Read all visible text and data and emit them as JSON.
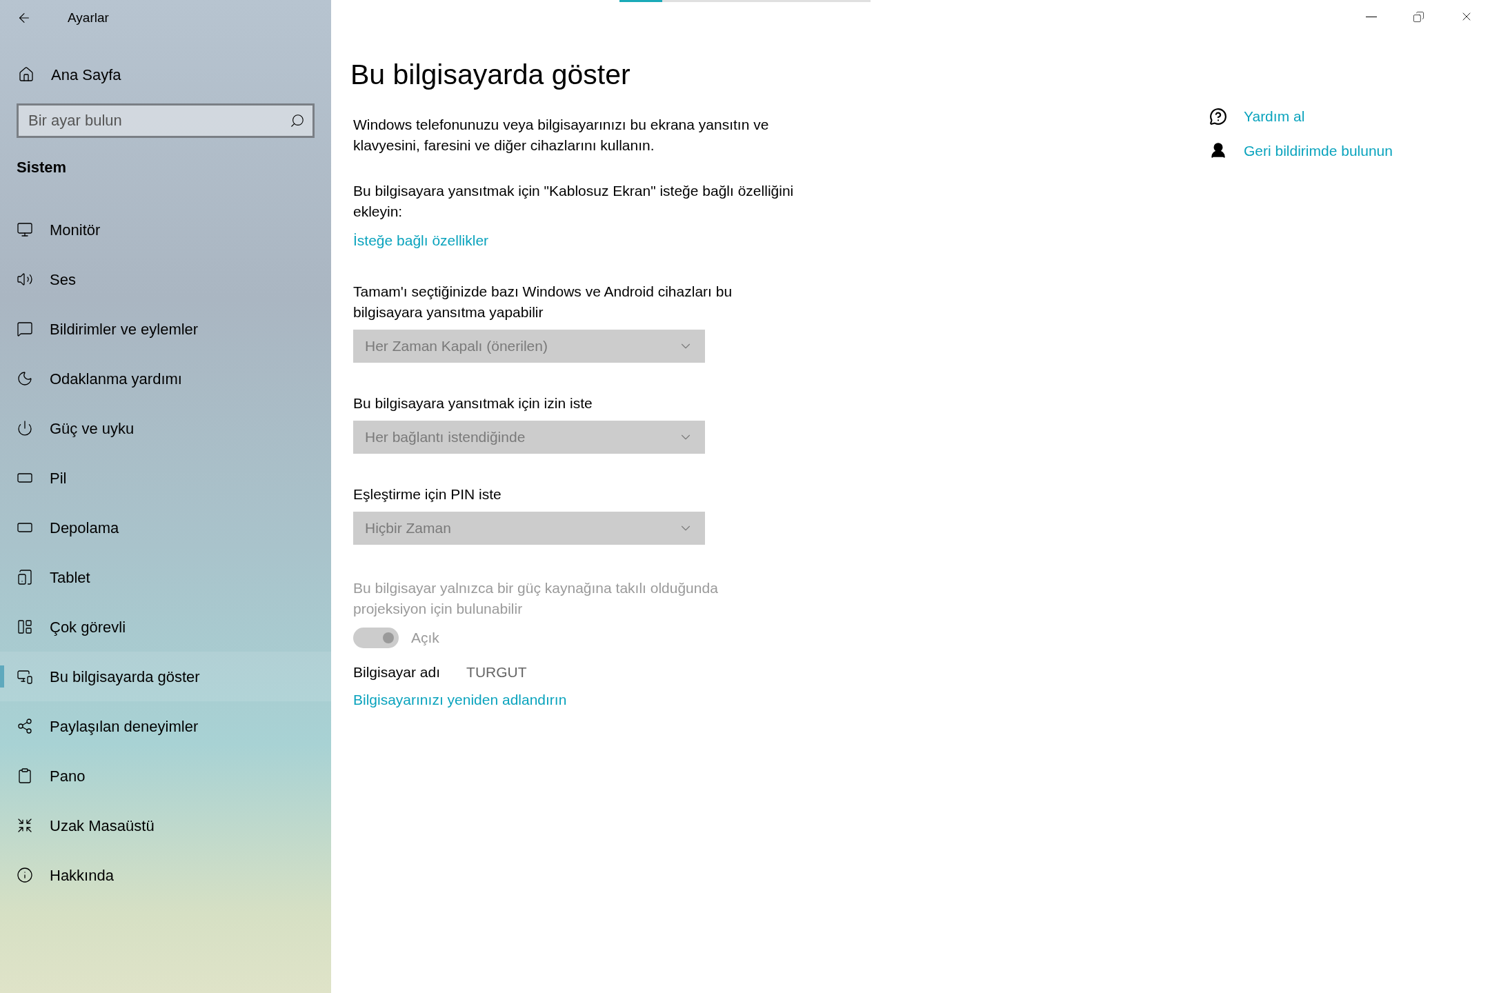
{
  "window": {
    "title": "Ayarlar"
  },
  "sidebar": {
    "home": "Ana Sayfa",
    "search": {
      "placeholder": "Bir ayar bulun"
    },
    "section": "Sistem",
    "items": [
      {
        "label": "Monitör",
        "selected": false
      },
      {
        "label": "Ses",
        "selected": false
      },
      {
        "label": "Bildirimler ve eylemler",
        "selected": false
      },
      {
        "label": "Odaklanma yardımı",
        "selected": false
      },
      {
        "label": "Güç ve uyku",
        "selected": false
      },
      {
        "label": "Pil",
        "selected": false
      },
      {
        "label": "Depolama",
        "selected": false
      },
      {
        "label": "Tablet",
        "selected": false
      },
      {
        "label": "Çok görevli",
        "selected": false
      },
      {
        "label": "Bu bilgisayarda göster",
        "selected": true
      },
      {
        "label": "Paylaşılan deneyimler",
        "selected": false
      },
      {
        "label": "Pano",
        "selected": false
      },
      {
        "label": "Uzak Masaüstü",
        "selected": false
      },
      {
        "label": "Hakkında",
        "selected": false
      }
    ]
  },
  "progress": {
    "level": 0.17
  },
  "page": {
    "title": "Bu bilgisayarda göster",
    "intro": "Windows telefonunuzu veya bilgisayarınızı bu ekrana yansıtın ve klavyesini, faresini ve diğer cihazlarını kullanın.",
    "feature_text": "Bu bilgisayara yansıtmak için \"Kablosuz Ekran\" isteğe bağlı özelliğini ekleyin:",
    "feature_link": "İsteğe bağlı özellikler",
    "dropdowns": [
      {
        "label": "Tamam'ı seçtiğinizde bazı Windows ve Android cihazları bu bilgisayara yansıtma yapabilir",
        "value": "Her Zaman Kapalı (önerilen)",
        "disabled": true
      },
      {
        "label": "Bu bilgisayara yansıtmak için izin iste",
        "value": "Her bağlantı istendiğinde",
        "disabled": true
      },
      {
        "label": "Eşleştirme için PIN iste",
        "value": "Hiçbir Zaman",
        "disabled": true
      }
    ],
    "power": {
      "label": "Bu bilgisayar yalnızca bir güç kaynağına takılı olduğunda projeksiyon için bulunabilir",
      "toggle": {
        "on": true,
        "disabled": true,
        "label": "Açık"
      }
    },
    "pc_name": {
      "label": "Bilgisayar adı",
      "value": "TURGUT"
    },
    "rename_link": "Bilgisayarınızı yeniden adlandırın"
  },
  "help": {
    "links": [
      "Yardım al",
      "Geri bildirimde bulunun"
    ]
  }
}
